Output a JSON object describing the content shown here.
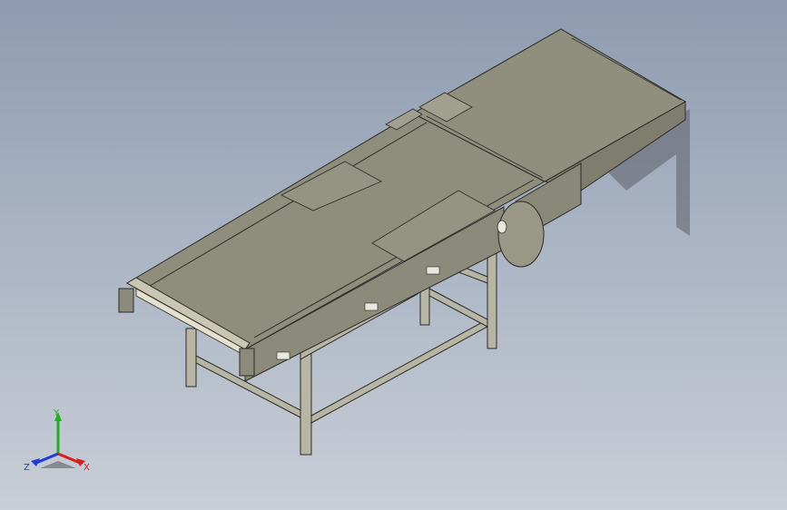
{
  "viewport": {
    "background_top": "#8e9bb0",
    "background_bottom": "#c9ced7",
    "model_color": "#8a8878",
    "edge_color": "#2a2a26"
  },
  "triad": {
    "x_label": "X",
    "y_label": "Y",
    "z_label": "Z",
    "x_color": "#d81e1e",
    "y_color": "#1fb01f",
    "z_color": "#1e3cd8"
  }
}
